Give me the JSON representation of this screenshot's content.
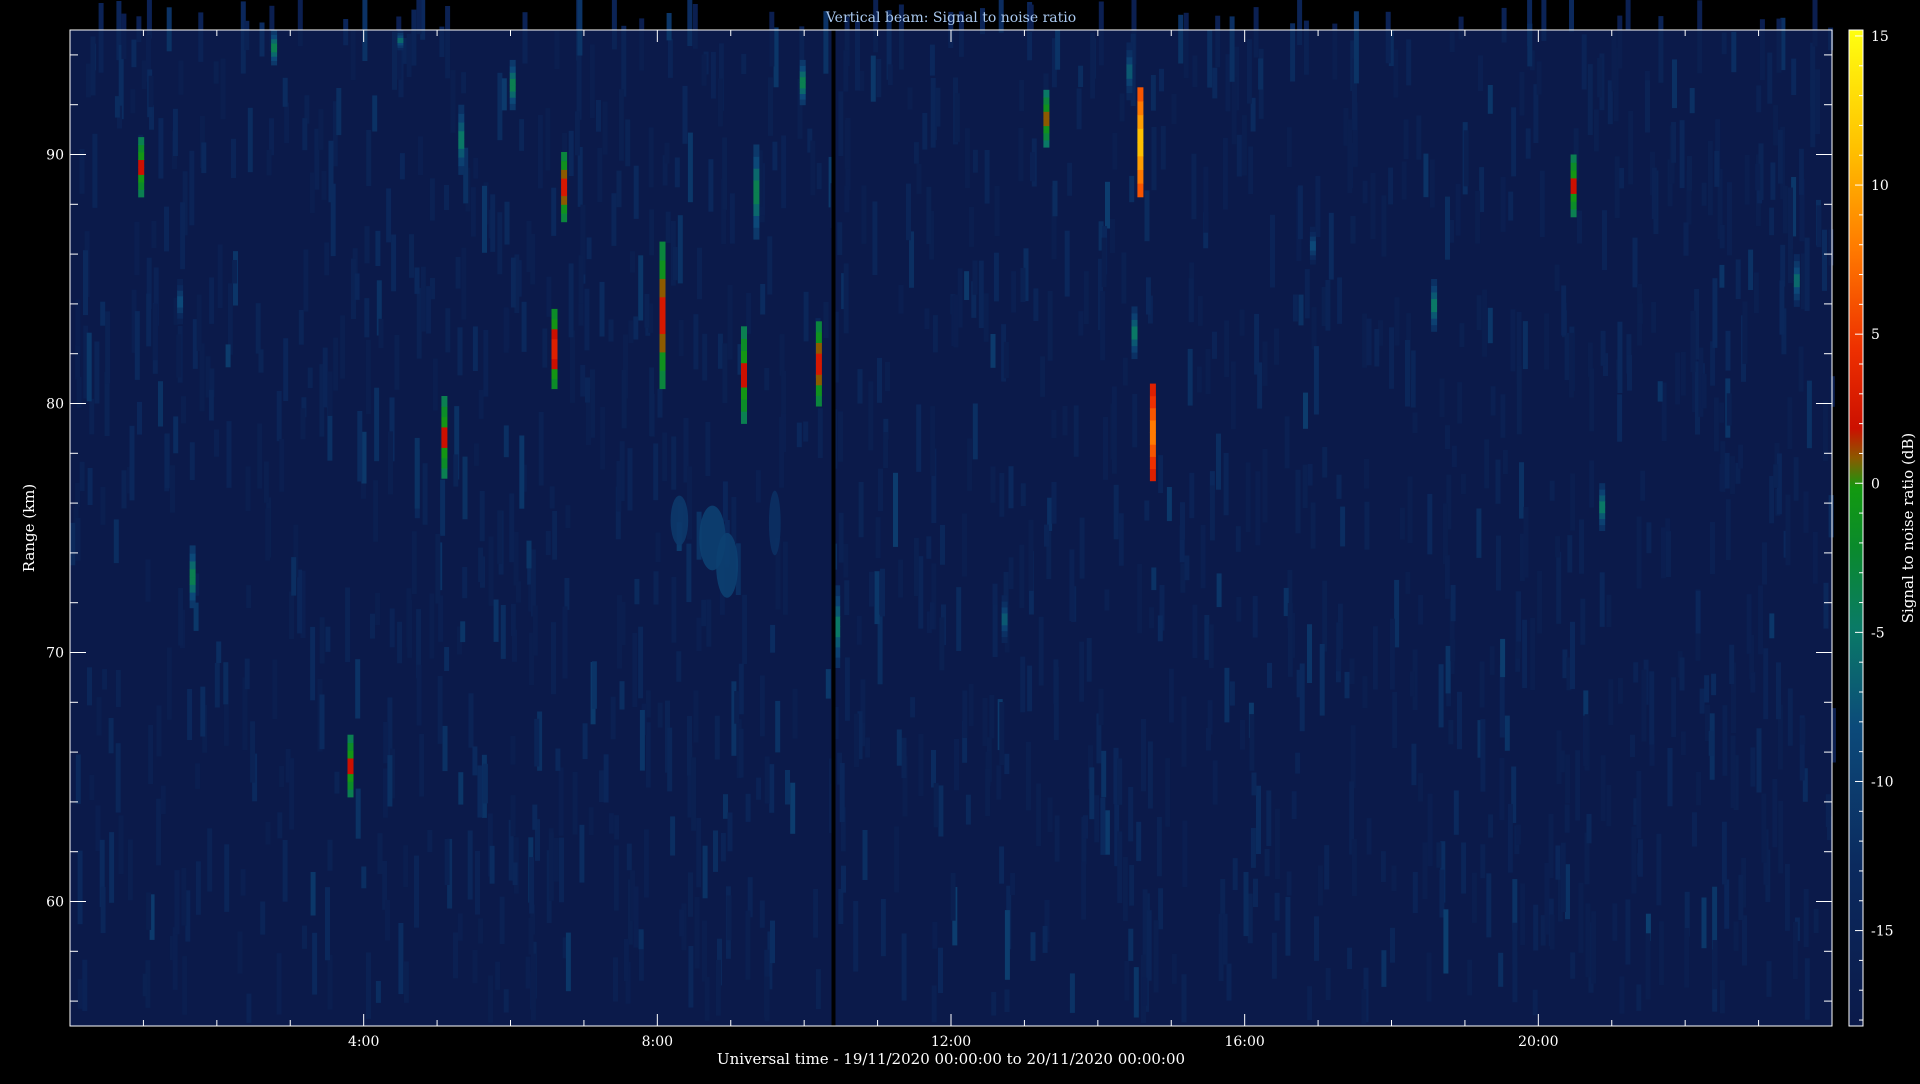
{
  "chart_data": {
    "type": "heatmap",
    "title": "Vertical beam: Signal to noise ratio",
    "xlabel": "Universal time - 19/11/2020 00:00:00 to 20/11/2020 00:00:00",
    "ylabel": "Range (km)",
    "x_unit": "hours UT",
    "xlim": [
      0,
      24
    ],
    "ylim": [
      55,
      95
    ],
    "x_ticks": [
      {
        "value": 4,
        "label": "4:00"
      },
      {
        "value": 8,
        "label": "8:00"
      },
      {
        "value": 12,
        "label": "12:00"
      },
      {
        "value": 16,
        "label": "16:00"
      },
      {
        "value": 20,
        "label": "20:00"
      }
    ],
    "y_ticks": [
      {
        "value": 60,
        "label": "60"
      },
      {
        "value": 70,
        "label": "70"
      },
      {
        "value": 80,
        "label": "80"
      },
      {
        "value": 90,
        "label": "90"
      }
    ],
    "colorbar": {
      "label": "Signal to noise ratio (dB)",
      "range": [
        -18.2,
        15.2
      ],
      "ticks": [
        {
          "value": 15,
          "label": "15"
        },
        {
          "value": 10,
          "label": "10"
        },
        {
          "value": 5,
          "label": "5"
        },
        {
          "value": 0,
          "label": "0"
        },
        {
          "value": -5,
          "label": "-5"
        },
        {
          "value": -10,
          "label": "-10"
        },
        {
          "value": -15,
          "label": "-15"
        }
      ]
    },
    "background_snr_db": -16,
    "data_gap": {
      "time": 10.4
    },
    "echoes": [
      {
        "time": 0.97,
        "range_min": 88.3,
        "range_max": 90.7,
        "peak_snr": 1
      },
      {
        "time": 1.67,
        "range_min": 71.8,
        "range_max": 74.3,
        "peak_snr": -5
      },
      {
        "time": 1.5,
        "range_min": 83.2,
        "range_max": 85.0,
        "peak_snr": -9
      },
      {
        "time": 2.78,
        "range_min": 93.6,
        "range_max": 95.0,
        "peak_snr": -5
      },
      {
        "time": 3.82,
        "range_min": 64.2,
        "range_max": 66.7,
        "peak_snr": 1
      },
      {
        "time": 4.5,
        "range_min": 94.2,
        "range_max": 95.0,
        "peak_snr": -7
      },
      {
        "time": 5.1,
        "range_min": 77.0,
        "range_max": 80.3,
        "peak_snr": 1
      },
      {
        "time": 5.33,
        "range_min": 89.2,
        "range_max": 92.0,
        "peak_snr": -6
      },
      {
        "time": 6.03,
        "range_min": 91.8,
        "range_max": 93.8,
        "peak_snr": -5
      },
      {
        "time": 6.6,
        "range_min": 80.6,
        "range_max": 83.8,
        "peak_snr": 3
      },
      {
        "time": 6.73,
        "range_min": 87.3,
        "range_max": 90.1,
        "peak_snr": 2
      },
      {
        "time": 8.07,
        "range_min": 80.6,
        "range_max": 86.5,
        "peak_snr": 2
      },
      {
        "time": 9.18,
        "range_min": 79.2,
        "range_max": 83.1,
        "peak_snr": 1
      },
      {
        "time": 9.35,
        "range_min": 86.6,
        "range_max": 90.4,
        "peak_snr": -5
      },
      {
        "time": 9.98,
        "range_min": 92.0,
        "range_max": 93.8,
        "peak_snr": -5
      },
      {
        "time": 10.2,
        "range_min": 79.9,
        "range_max": 83.3,
        "peak_snr": 2
      },
      {
        "time": 10.45,
        "range_min": 69.4,
        "range_max": 72.7,
        "peak_snr": -6
      },
      {
        "time": 12.73,
        "range_min": 70.4,
        "range_max": 72.3,
        "peak_snr": -8
      },
      {
        "time": 13.3,
        "range_min": 90.3,
        "range_max": 92.6,
        "peak_snr": 0
      },
      {
        "time": 14.43,
        "range_min": 92.2,
        "range_max": 94.5,
        "peak_snr": -8
      },
      {
        "time": 14.5,
        "range_min": 81.8,
        "range_max": 83.9,
        "peak_snr": -6
      },
      {
        "time": 14.58,
        "range_min": 88.3,
        "range_max": 92.7,
        "peak_snr": 13
      },
      {
        "time": 14.75,
        "range_min": 76.9,
        "range_max": 80.8,
        "peak_snr": 9
      },
      {
        "time": 16.93,
        "range_min": 85.6,
        "range_max": 87.1,
        "peak_snr": -9
      },
      {
        "time": 18.58,
        "range_min": 82.9,
        "range_max": 85.0,
        "peak_snr": -6
      },
      {
        "time": 20.48,
        "range_min": 87.5,
        "range_max": 90.0,
        "peak_snr": 1
      },
      {
        "time": 20.87,
        "range_min": 74.9,
        "range_max": 76.8,
        "peak_snr": -6
      },
      {
        "time": 23.52,
        "range_min": 83.9,
        "range_max": 86.0,
        "peak_snr": -7
      }
    ],
    "diffuse_patches": [
      {
        "time": 8.3,
        "range": 75.3,
        "range_halfwidth": 1.0,
        "time_halfwidth": 0.12,
        "peak_snr": -12
      },
      {
        "time": 8.75,
        "range": 74.6,
        "range_halfwidth": 1.3,
        "time_halfwidth": 0.18,
        "peak_snr": -11
      },
      {
        "time": 8.95,
        "range": 73.5,
        "range_halfwidth": 1.3,
        "time_halfwidth": 0.15,
        "peak_snr": -11
      },
      {
        "time": 9.6,
        "range": 75.2,
        "range_halfwidth": 1.3,
        "time_halfwidth": 0.08,
        "peak_snr": -13
      }
    ]
  }
}
